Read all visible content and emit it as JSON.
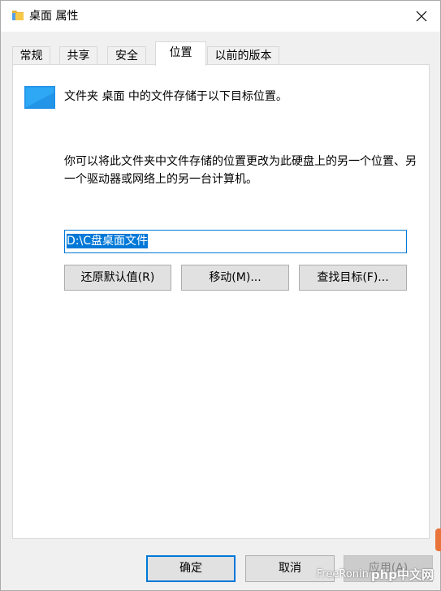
{
  "window": {
    "title": "桌面 属性"
  },
  "tabs": [
    {
      "label": "常规",
      "active": false
    },
    {
      "label": "共享",
      "active": false
    },
    {
      "label": "安全",
      "active": false
    },
    {
      "label": "位置",
      "active": true
    },
    {
      "label": "以前的版本",
      "active": false
    }
  ],
  "location": {
    "info_text": "文件夹 桌面 中的文件存储于以下目标位置。",
    "description": "你可以将此文件夹中文件存储的位置更改为此硬盘上的另一个位置、另一个驱动器或网络上的另一台计算机。",
    "path_value": "D:\\C盘桌面文件",
    "restore_default_label": "还原默认值(R)",
    "move_label": "移动(M)...",
    "find_target_label": "查找目标(F)..."
  },
  "footer": {
    "ok_label": "确定",
    "cancel_label": "取消",
    "apply_label": "应用(A)"
  },
  "watermark": {
    "brand": "FreeRonin",
    "site": "php中文网"
  },
  "colors": {
    "accent": "#0078d7",
    "button_face": "#e1e1e1",
    "button_border": "#adadad",
    "disabled_text": "#838383"
  }
}
